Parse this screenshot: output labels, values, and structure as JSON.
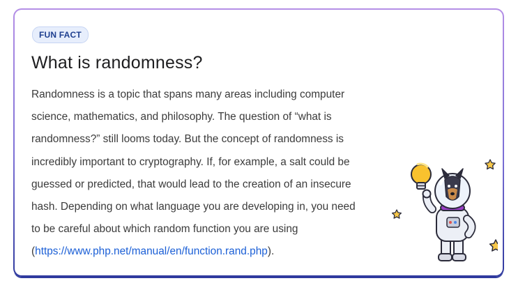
{
  "card": {
    "badge": "FUN FACT",
    "title": "What is randomness?",
    "body_lead": "Randomness is a topic that spans many areas including computer science, mathematics, and philosophy. The question of “what is randomness?” still looms today. But the concept of randomness is incredibly important to cryptography. If, for example, a salt could be guessed or predicted, that would lead to the creation of an insecure hash. Depending on what language you are developing in, you need to be careful about which random function you are using (",
    "link_text": "https://www.php.net/manual/en/function.rand.php",
    "body_tail": ")."
  },
  "colors": {
    "accent": "#7b6fd6",
    "link": "#1b5fd6",
    "badge_text": "#1e3f8f"
  },
  "illustration": {
    "icon": "astronaut-dog-with-lightbulb-illustration"
  }
}
